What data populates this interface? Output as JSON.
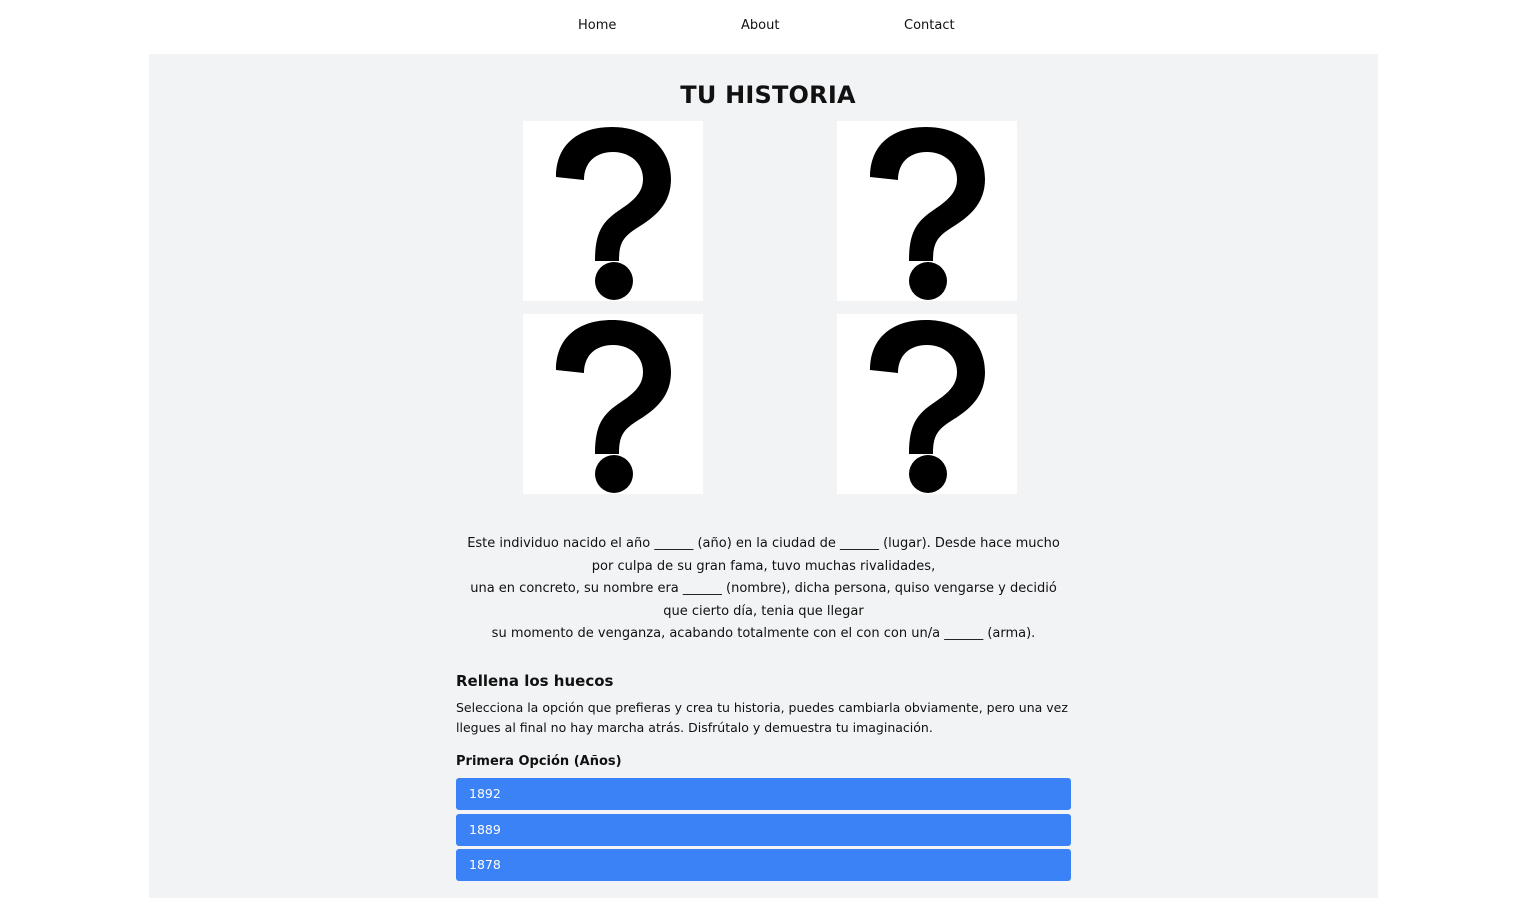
{
  "nav": {
    "home": "Home",
    "about": "About",
    "contact": "Contact"
  },
  "page": {
    "title": "TU HISTORIA"
  },
  "mystery_images": {
    "icon": "question-mark-icon",
    "count": 4
  },
  "story": {
    "line1": "Este individuo nacido el año ______ (año) en la ciudad de ______ (lugar). Desde hace mucho por culpa de su gran fama, tuvo muchas rivalidades,",
    "line2": "una en concreto, su nombre era ______ (nombre), dicha persona, quiso vengarse y decidió que cierto día, tenia que llegar",
    "line3": "su momento de venganza, acabando totalmente con el con con un/a ______ (arma)."
  },
  "fill_section": {
    "heading": "Rellena los huecos",
    "description": "Selecciona la opción que prefieras y crea tu historia, puedes cambiarla obviamente, pero una vez llegues al final no hay marcha atrás. Disfrútalo y demuestra tu imaginación.",
    "first_option_label": "Primera Opción (Años)",
    "options": [
      "1892",
      "1889",
      "1878"
    ]
  },
  "colors": {
    "panel_background": "#f2f3f5",
    "button_background": "#3b82f6",
    "button_text": "#ffffff"
  }
}
